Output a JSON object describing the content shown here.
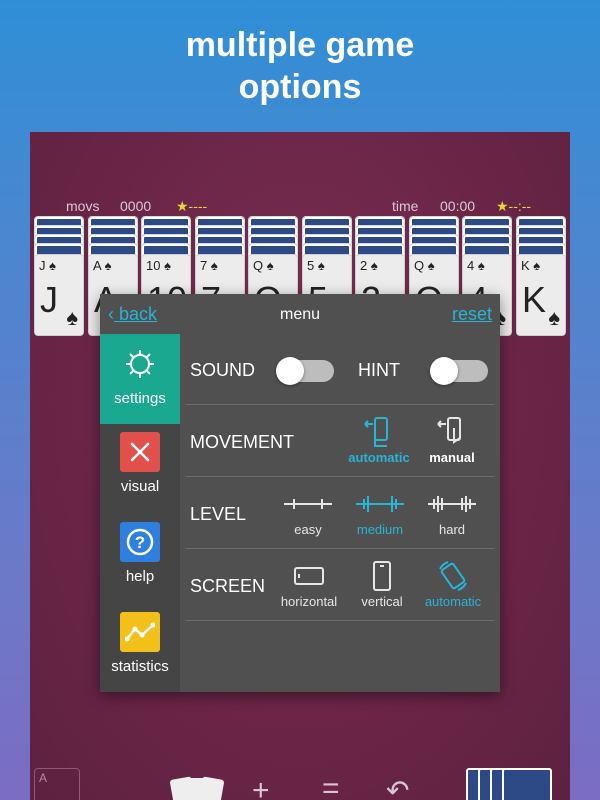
{
  "headline": {
    "line1": "multiple game",
    "line2": "options"
  },
  "stats": {
    "moves_label": "movs",
    "moves_value": "0000",
    "moves_stars": "★----",
    "time_label": "time",
    "time_value": "00:00",
    "time_stars": "★--:--"
  },
  "columns": [
    {
      "rank": "J",
      "suit": "♠"
    },
    {
      "rank": "A",
      "suit": "♠"
    },
    {
      "rank": "10",
      "suit": "♠"
    },
    {
      "rank": "7",
      "suit": "♠"
    },
    {
      "rank": "Q",
      "suit": "♠"
    },
    {
      "rank": "5",
      "suit": "♠"
    },
    {
      "rank": "2",
      "suit": "♠"
    },
    {
      "rank": "Q",
      "suit": "♠"
    },
    {
      "rank": "4",
      "suit": "♠"
    },
    {
      "rank": "K",
      "suit": "♠"
    }
  ],
  "menu": {
    "back": "back",
    "title": "menu",
    "reset": "reset",
    "sidebar": [
      {
        "label": "settings",
        "icon": "gear-icon",
        "color": "#1aa891"
      },
      {
        "label": "visual",
        "icon": "brush-icon",
        "color": "#e2504c"
      },
      {
        "label": "help",
        "icon": "question-icon",
        "color": "#2f7fe0"
      },
      {
        "label": "statistics",
        "icon": "chart-icon",
        "color": "#f2c018"
      }
    ],
    "sound_label": "SOUND",
    "hint_label": "HINT",
    "movement": {
      "label": "MOVEMENT",
      "opt1": "automatic",
      "opt2": "manual",
      "selected": "automatic"
    },
    "level": {
      "label": "LEVEL",
      "opt1": "easy",
      "opt2": "medium",
      "opt3": "hard",
      "selected": "medium"
    },
    "screen": {
      "label": "SCREEN",
      "opt1": "horizontal",
      "opt2": "vertical",
      "opt3": "automatic",
      "selected": "automatic"
    }
  },
  "bottom": {
    "foundation_label": "A"
  },
  "colors": {
    "accent": "#28b4d6",
    "settings_active": "#1aa891",
    "menu_bg": "#505050",
    "felt": "#6a2546"
  }
}
